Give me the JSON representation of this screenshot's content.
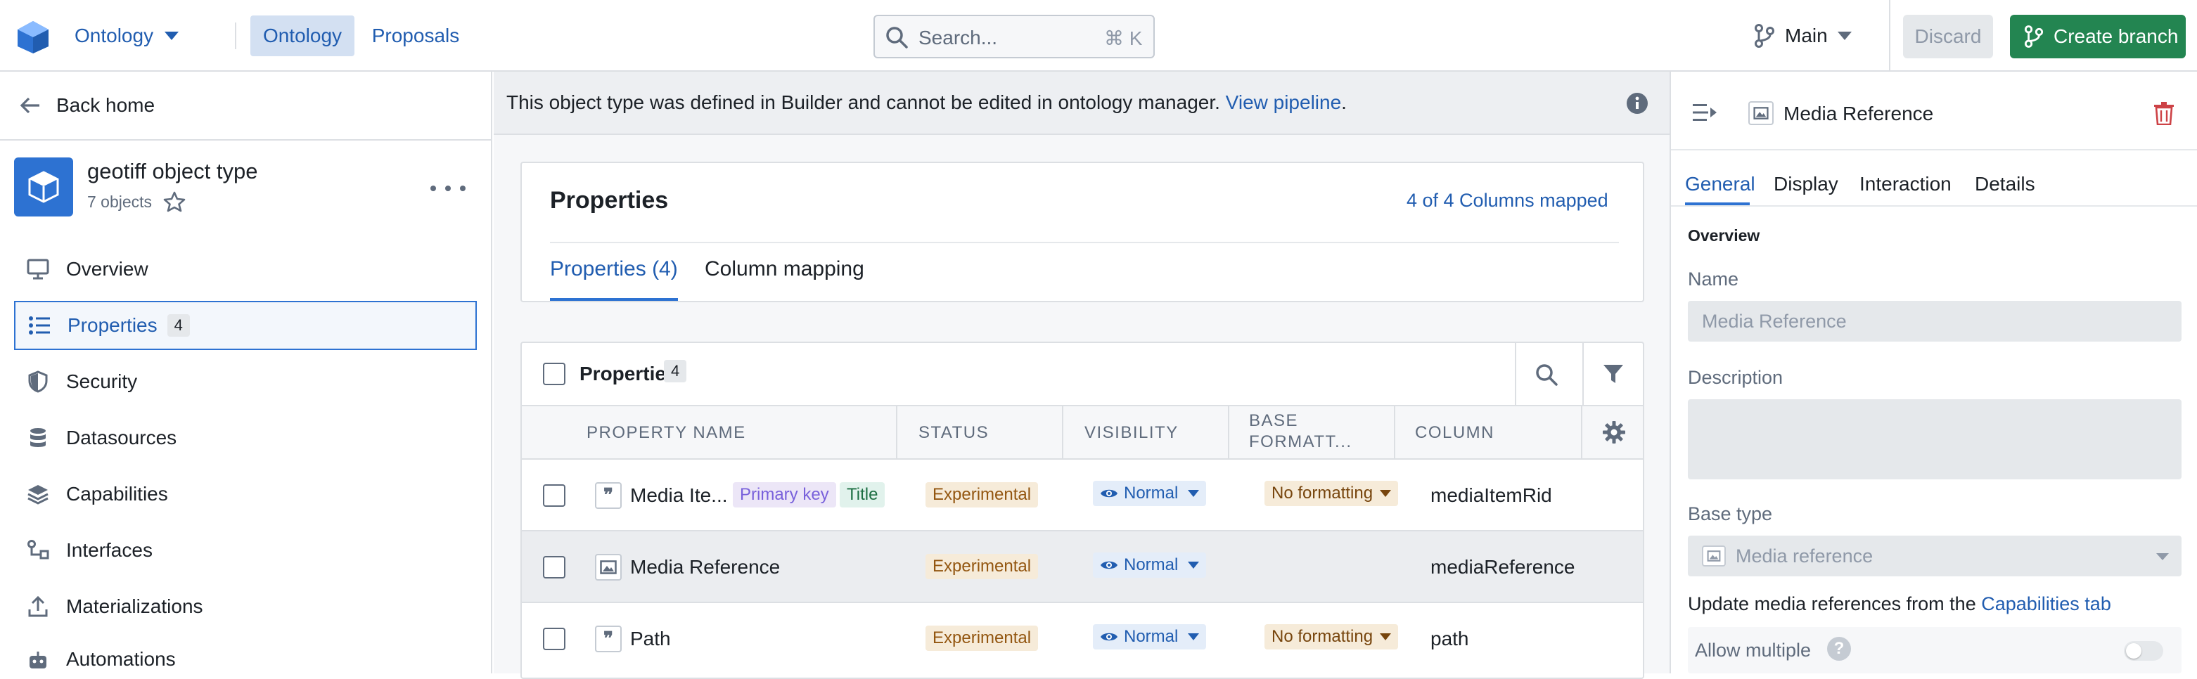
{
  "topbar": {
    "app_menu_label": "Ontology",
    "tabs": [
      "Ontology",
      "Proposals"
    ],
    "search_placeholder": "Search...",
    "search_shortcut": "⌘ K",
    "branch_label": "Main",
    "discard_label": "Discard",
    "create_branch_label": "Create branch"
  },
  "sidebar": {
    "back_label": "Back home",
    "object_title": "geotiff object type",
    "object_count": "7 objects",
    "items": [
      {
        "label": "Overview",
        "icon": "desktop-icon"
      },
      {
        "label": "Properties",
        "icon": "list-icon",
        "count": "4"
      },
      {
        "label": "Security",
        "icon": "shield-icon"
      },
      {
        "label": "Datasources",
        "icon": "database-icon"
      },
      {
        "label": "Capabilities",
        "icon": "layers-icon"
      },
      {
        "label": "Interfaces",
        "icon": "interface-icon"
      },
      {
        "label": "Materializations",
        "icon": "export-icon"
      },
      {
        "label": "Automations",
        "icon": "robot-icon"
      }
    ]
  },
  "banner": {
    "text": "This object type was defined in Builder and cannot be edited in ontology manager.",
    "link": "View pipeline",
    "period": "."
  },
  "properties_card": {
    "title": "Properties",
    "mapped": "4 of 4 Columns mapped",
    "tabs": [
      "Properties (4)",
      "Column mapping"
    ]
  },
  "table": {
    "title": "Properties",
    "count": "4",
    "headers": [
      "PROPERTY NAME",
      "STATUS",
      "VISIBILITY",
      "BASE FORMATT...",
      "COLUMN"
    ],
    "rows": [
      {
        "name": "Media Ite...",
        "tags": [
          "Primary key",
          "Title"
        ],
        "status": "Experimental",
        "visibility": "Normal",
        "formatting": "No formatting",
        "column": "mediaItemRid",
        "icon": "quote-icon"
      },
      {
        "name": "Media Reference",
        "tags": [],
        "status": "Experimental",
        "visibility": "Normal",
        "formatting": "",
        "column": "mediaReference",
        "icon": "image-icon"
      },
      {
        "name": "Path",
        "tags": [],
        "status": "Experimental",
        "visibility": "Normal",
        "formatting": "No formatting",
        "column": "path",
        "icon": "quote-icon"
      }
    ]
  },
  "right_panel": {
    "title": "Media Reference",
    "tabs": [
      "General",
      "Display",
      "Interaction",
      "Details"
    ],
    "section": "Overview",
    "name_label": "Name",
    "name_value": "Media Reference",
    "description_label": "Description",
    "base_type_label": "Base type",
    "base_type_value": "Media reference",
    "update_text": "Update media references from the",
    "update_link": "Capabilities tab",
    "allow_multiple_label": "Allow multiple"
  },
  "colors": {
    "accent": "#215db0",
    "create_branch": "#238551",
    "delete": "#cd4246"
  }
}
